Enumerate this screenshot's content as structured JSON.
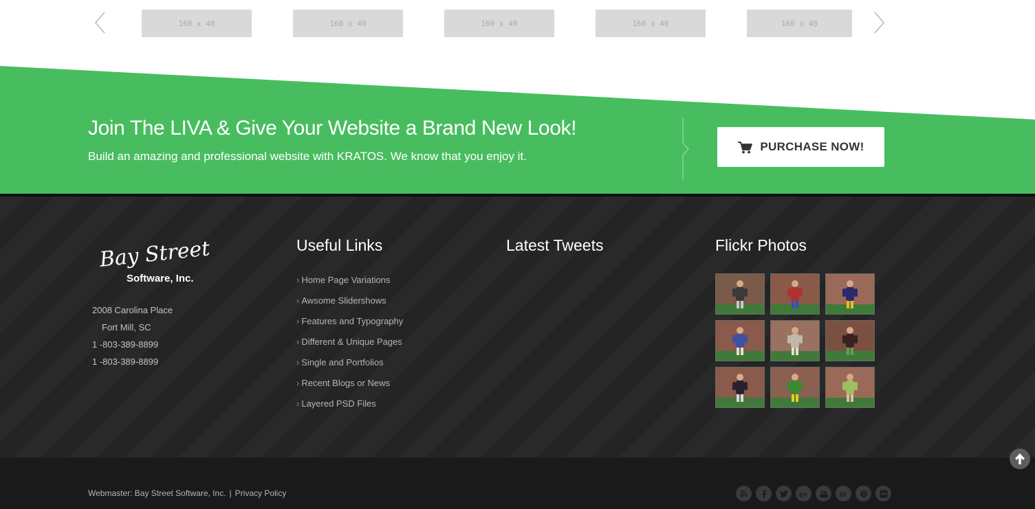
{
  "carousel": {
    "logos": [
      "160 x 40",
      "160 x 40",
      "160 x 40",
      "160 x 40",
      "160 x 40"
    ]
  },
  "banner": {
    "title": "Join The LIVA & Give Your Website a Brand New Look!",
    "subtitle": "Build an amazing and professional website with KRATOS. We know that you enjoy it.",
    "button_label": "PURCHASE NOW!",
    "button_icon": "shopping-cart-icon",
    "color": "#48bd5f"
  },
  "company": {
    "logo_line1": "Bay Street",
    "logo_line2": "Software, Inc.",
    "address_line1": "2008 Carolina Place",
    "address_line2": "Fort Mill, SC",
    "phone1": "1 -803-389-8899",
    "phone2": "1 -803-389-8899"
  },
  "useful_links": {
    "title": "Useful Links",
    "items": [
      "Home Page Variations",
      "Awsome Slidershows",
      "Features and Typography",
      "Different & Unique Pages",
      "Single and Portfolios",
      "Recent Blogs or News",
      "Layered PSD Files"
    ]
  },
  "latest_tweets": {
    "title": "Latest Tweets"
  },
  "flickr": {
    "title": "Flickr Photos",
    "photos": [
      {
        "bg": "#7a5a48",
        "fig": "#3a3a3a",
        "accent": "#c8c8c8"
      },
      {
        "bg": "#8a5a48",
        "fig": "#b03030",
        "accent": "#3050c0"
      },
      {
        "bg": "#9a6a58",
        "fig": "#2a2a6a",
        "accent": "#e0c020"
      },
      {
        "bg": "#8a5a4a",
        "fig": "#4050a0",
        "accent": "#e8e0d0"
      },
      {
        "bg": "#9a7060",
        "fig": "#c0b8a8",
        "accent": "#e8e0d0"
      },
      {
        "bg": "#7a5040",
        "fig": "#3a2020",
        "accent": "#60a050"
      },
      {
        "bg": "#8a5a4a",
        "fig": "#2a2030",
        "accent": "#d8d8d8"
      },
      {
        "bg": "#8a6050",
        "fig": "#3a8a30",
        "accent": "#e0d020"
      },
      {
        "bg": "#9a6a58",
        "fig": "#a0c060",
        "accent": "#e0c0a0"
      }
    ]
  },
  "bottom_bar": {
    "webmaster": "Webmaster: Bay Street Software, Inc.",
    "separator": "|",
    "privacy": "Privacy Policy"
  },
  "social_icons": [
    "rss-icon",
    "facebook-icon",
    "twitter-icon",
    "google-plus-icon",
    "youtube-icon",
    "linkedin-icon",
    "skype-icon",
    "flickr-icon"
  ],
  "colors": {
    "footer_bg": "#242424",
    "bottom_bar_bg": "#1a1a1a",
    "link_text": "#b5b5b5"
  }
}
